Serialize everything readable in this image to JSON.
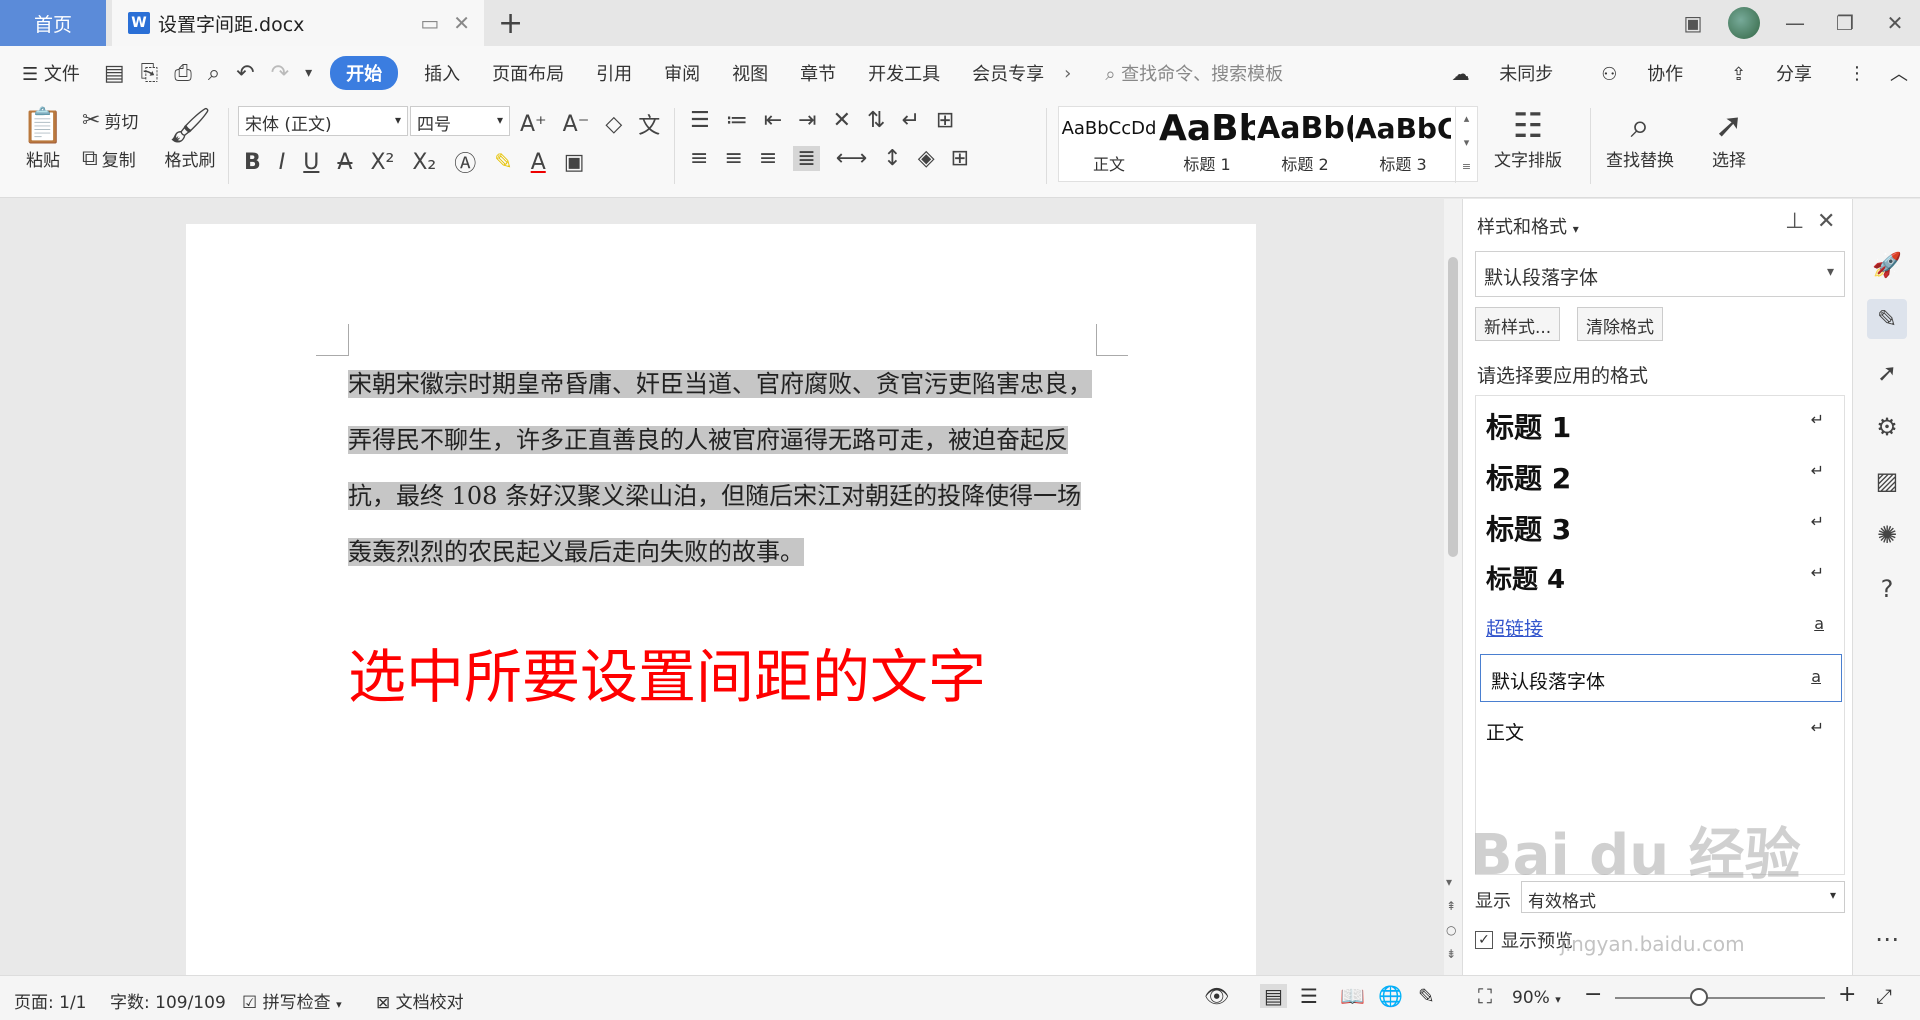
{
  "titlebar": {
    "home_tab": "首页",
    "doc_tab": "设置字间距.docx",
    "doc_icon": "W"
  },
  "menubar": {
    "file": "文件",
    "items": [
      "开始",
      "插入",
      "页面布局",
      "引用",
      "审阅",
      "视图",
      "章节",
      "开发工具",
      "会员专享"
    ],
    "search_placeholder": "查找命令、搜索模板",
    "sync": "未同步",
    "collab": "协作",
    "share": "分享"
  },
  "ribbon": {
    "paste": "粘贴",
    "cut": "剪切",
    "copy": "复制",
    "format_painter": "格式刷",
    "font_name": "宋体 (正文)",
    "font_size": "四号",
    "styles": [
      {
        "sample": "AaBbCcDd",
        "label": "正文"
      },
      {
        "sample": "AaBb",
        "label": "标题 1"
      },
      {
        "sample": "AaBb(",
        "label": "标题 2"
      },
      {
        "sample": "AaBbC",
        "label": "标题 3"
      }
    ],
    "text_layout": "文字排版",
    "find_replace": "查找替换",
    "select": "选择"
  },
  "document": {
    "paragraph": "宋朝宋徽宗时期皇帝昏庸、奸臣当道、官府腐败、贪官污吏陷害忠良，弄得民不聊生，许多正直善良的人被官府逼得无路可走，被迫奋起反抗，最终 108 条好汉聚义梁山泊，但随后宋江对朝廷的投降使得一场轰轰烈烈的农民起义最后走向失败的故事。",
    "annotation": "选中所要设置间距的文字"
  },
  "styles_panel": {
    "title": "样式和格式",
    "current_style": "默认段落字体",
    "new_style": "新样式...",
    "clear_format": "清除格式",
    "choose_label": "请选择要应用的格式",
    "items": [
      {
        "label": "标题  1",
        "mark": "↵"
      },
      {
        "label": "标题  2",
        "mark": "↵"
      },
      {
        "label": "标题  3",
        "mark": "↵"
      },
      {
        "label": "标题  4",
        "mark": "↵"
      },
      {
        "label": "超链接",
        "mark": "a"
      },
      {
        "label": "默认段落字体",
        "mark": "a"
      },
      {
        "label": "正文",
        "mark": "↵"
      }
    ],
    "show_label": "显示",
    "show_value": "有效格式",
    "preview_label": "显示预览"
  },
  "statusbar": {
    "page": "页面: 1/1",
    "words": "字数: 109/109",
    "spell_check": "拼写检查",
    "doc_proof": "文档校对",
    "zoom": "90%"
  },
  "watermark": {
    "main": "Bai du 经验",
    "url": "jingyan.baidu.com"
  },
  "colors": {
    "accent": "#3b7de0",
    "home_tab": "#5b8bd9",
    "selection": "#c6c6c6",
    "annotation": "#ff0000"
  }
}
